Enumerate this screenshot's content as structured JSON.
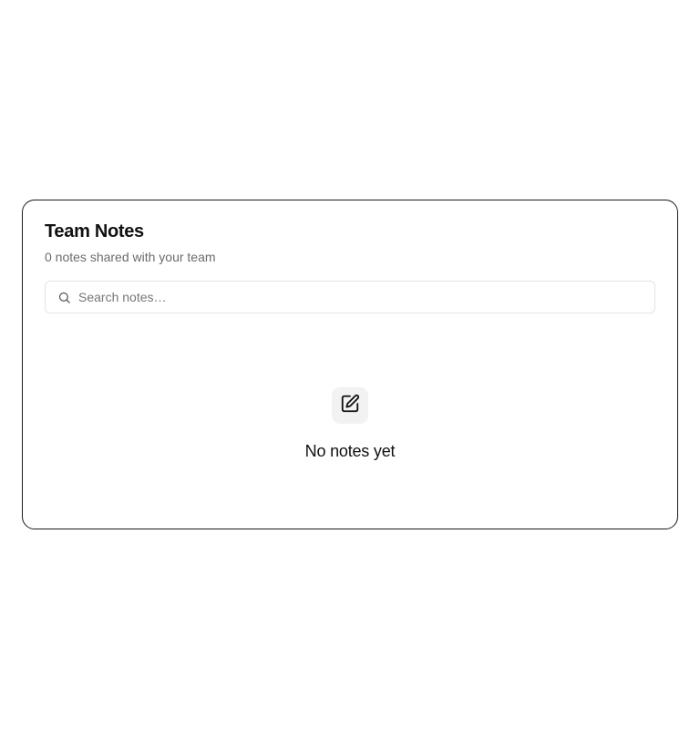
{
  "notes_panel": {
    "title": "Team Notes",
    "subtitle": "0 notes shared with your team",
    "search": {
      "placeholder": "Search notes…",
      "value": "",
      "icon": "search-icon"
    },
    "empty_state": {
      "icon": "edit-note-icon",
      "message": "No notes yet"
    }
  },
  "colors": {
    "text_primary": "#111111",
    "text_secondary": "#6b6b6b",
    "border": "#1a1a1a",
    "input_border": "#e3e3e3",
    "icon_bg": "#f2f2f2"
  }
}
